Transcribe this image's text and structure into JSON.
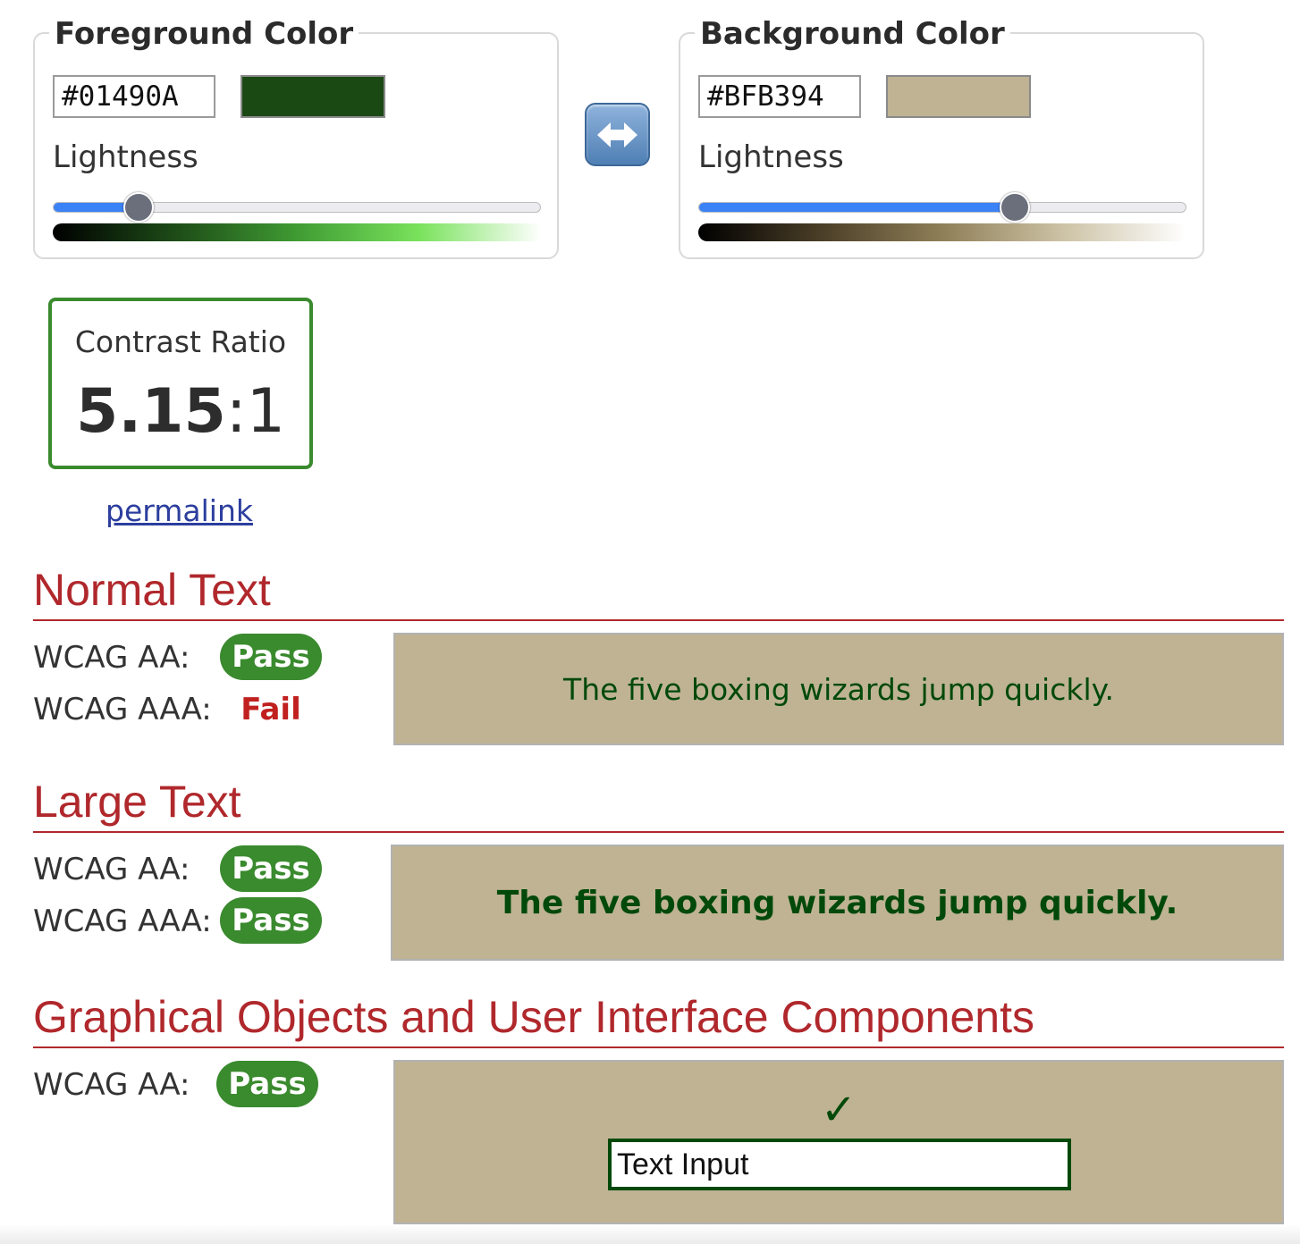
{
  "foreground": {
    "legend": "Foreground Color",
    "hex_value": "#01490A",
    "swatch_color": "#1b4914",
    "lightness_label": "Lightness",
    "lightness_fraction": 0.175,
    "gradient": [
      "#000000",
      "#1d4b17",
      "#3f9b33",
      "#79e25c",
      "#ffffff"
    ]
  },
  "swap_button": {
    "icon": "left-right-arrow-icon"
  },
  "background": {
    "legend": "Background Color",
    "hex_value": "#BFB394",
    "swatch_color": "#BFB394",
    "lightness_label": "Lightness",
    "lightness_fraction": 0.648,
    "gradient": [
      "#000000",
      "#4a3e27",
      "#8f7f58",
      "#cdc3a6",
      "#ffffff"
    ]
  },
  "contrast": {
    "label": "Contrast Ratio",
    "value_main": "5.15",
    "value_rest": ":1",
    "border_color": "#3a8a2e"
  },
  "permalink": "permalink",
  "normal_text": {
    "title": "Normal Text",
    "aa_label": "WCAG AA:",
    "aa_result": "Pass",
    "aaa_label": "WCAG AAA:",
    "aaa_result": "Fail",
    "sample": "The five boxing wizards jump quickly."
  },
  "large_text": {
    "title": "Large Text",
    "aa_label": "WCAG AA:",
    "aa_result": "Pass",
    "aaa_label": "WCAG AAA:",
    "aaa_result": "Pass",
    "sample": "The five boxing wizards jump quickly."
  },
  "graphical": {
    "title": "Graphical Objects and User Interface Components",
    "aa_label": "WCAG AA:",
    "aa_result": "Pass",
    "check_icon": "checkmark-icon",
    "check_glyph": "✓",
    "input_value": "Text Input"
  },
  "colors": {
    "pass": "#3a8a2e",
    "fail": "#c0211f",
    "heading": "#b0282c",
    "sample_fg": "#01490A",
    "sample_bg": "#BFB394"
  }
}
